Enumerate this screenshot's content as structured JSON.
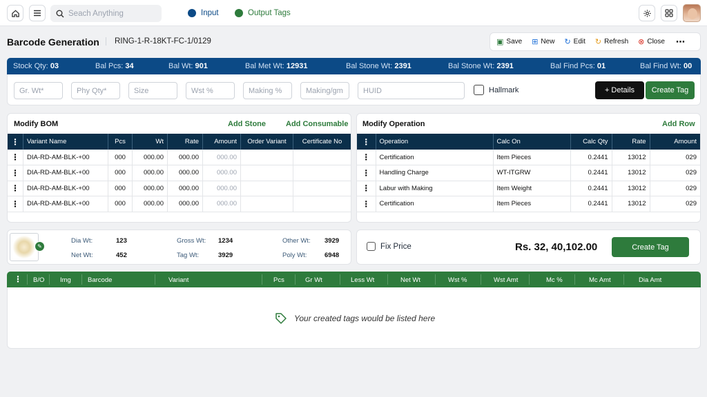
{
  "topbar": {
    "search_placeholder": "Seach Anything",
    "legend": [
      {
        "label": "Input",
        "color": "#0c4a86"
      },
      {
        "label": "Output Tags",
        "color": "#2e7b3c"
      }
    ],
    "icons": [
      "home-icon",
      "menu-icon",
      "search-icon",
      "gear-icon",
      "apps-grid-icon",
      "avatar"
    ]
  },
  "header": {
    "title": "Barcode Generation",
    "sku": "RING-1-R-18KT-FC-1/0129",
    "actions": [
      {
        "label": "Save",
        "icon": "save-icon",
        "color": "#2e7b3c"
      },
      {
        "label": "New",
        "icon": "new-icon",
        "color": "#1d6fd8"
      },
      {
        "label": "Edit",
        "icon": "edit-refresh-icon",
        "color": "#1d6fd8"
      },
      {
        "label": "Refresh",
        "icon": "refresh-icon",
        "color": "#e49b1c"
      },
      {
        "label": "Close",
        "icon": "close-icon",
        "color": "#d92d20"
      }
    ],
    "more": "⋯"
  },
  "stats": [
    {
      "label": "Stock Qty:",
      "value": "03"
    },
    {
      "label": "Bal Pcs:",
      "value": "34"
    },
    {
      "label": "Bal Wt:",
      "value": "901"
    },
    {
      "label": "Bal Met Wt:",
      "value": "12931"
    },
    {
      "label": "Bal Stone Wt:",
      "value": "2391"
    },
    {
      "label": "Bal Stone Wt:",
      "value": "2391"
    },
    {
      "label": "Bal Find Pcs:",
      "value": "01"
    },
    {
      "label": "Bal Find Wt:",
      "value": "00"
    }
  ],
  "inputs": {
    "fields": [
      "Gr. Wt*",
      "Phy Qty*",
      "Size",
      "Wst %",
      "Making %",
      "Making/gm",
      "HUID"
    ],
    "hallmark_label": "Hallmark",
    "details_label": "+ Details",
    "create_tag_label": "Create Tag"
  },
  "bom": {
    "title": "Modify BOM",
    "add_stone": "Add Stone",
    "add_consumable": "Add Consumable",
    "columns": [
      "Variant Name",
      "Pcs",
      "Wt",
      "Rate",
      "Amount",
      "Order Variant",
      "Certificate No"
    ],
    "rows": [
      [
        "DIA-RD-AM-BLK-+00",
        "000",
        "000.00",
        "000.00",
        "000.00",
        "",
        ""
      ],
      [
        "DIA-RD-AM-BLK-+00",
        "000",
        "000.00",
        "000.00",
        "000.00",
        "",
        ""
      ],
      [
        "DIA-RD-AM-BLK-+00",
        "000",
        "000.00",
        "000.00",
        "000.00",
        "",
        ""
      ],
      [
        "DIA-RD-AM-BLK-+00",
        "000",
        "000.00",
        "000.00",
        "000.00",
        "",
        ""
      ]
    ]
  },
  "operation": {
    "title": "Modify Operation",
    "add_row": "Add Row",
    "columns": [
      "Operation",
      "Calc On",
      "Calc Qty",
      "Rate",
      "Amount"
    ],
    "rows": [
      [
        "Certification",
        "Item Pieces",
        "0.2441",
        "13012",
        "029"
      ],
      [
        "Handling Charge",
        "WT-ITGRW",
        "0.2441",
        "13012",
        "029"
      ],
      [
        "Labur with Making",
        "Item Weight",
        "0.2441",
        "13012",
        "029"
      ],
      [
        "Certification",
        "Item Pieces",
        "0.2441",
        "13012",
        "029"
      ]
    ]
  },
  "weights": [
    {
      "label": "Dia Wt:",
      "value": "123"
    },
    {
      "label": "Net Wt:",
      "value": "452"
    },
    {
      "label": "Gross Wt:",
      "value": "1234"
    },
    {
      "label": "Tag Wt:",
      "value": "3929"
    },
    {
      "label": "Other Wt:",
      "value": "3929"
    },
    {
      "label": "Poly Wt:",
      "value": "6948"
    }
  ],
  "price": {
    "fix_price_label": "Fix Price",
    "total": "Rs. 32, 40,102.00",
    "create_tag_label": "Create Tag"
  },
  "tags_table": {
    "columns": [
      "B/O",
      "Img",
      "Barcode",
      "Variant",
      "Pcs",
      "Gr Wt",
      "Less Wt",
      "Net Wt",
      "Wst %",
      "Wst Amt",
      "Mc %",
      "Mc Amt",
      "Dia Amt"
    ],
    "empty_message": "Your created tags would be listed here"
  }
}
